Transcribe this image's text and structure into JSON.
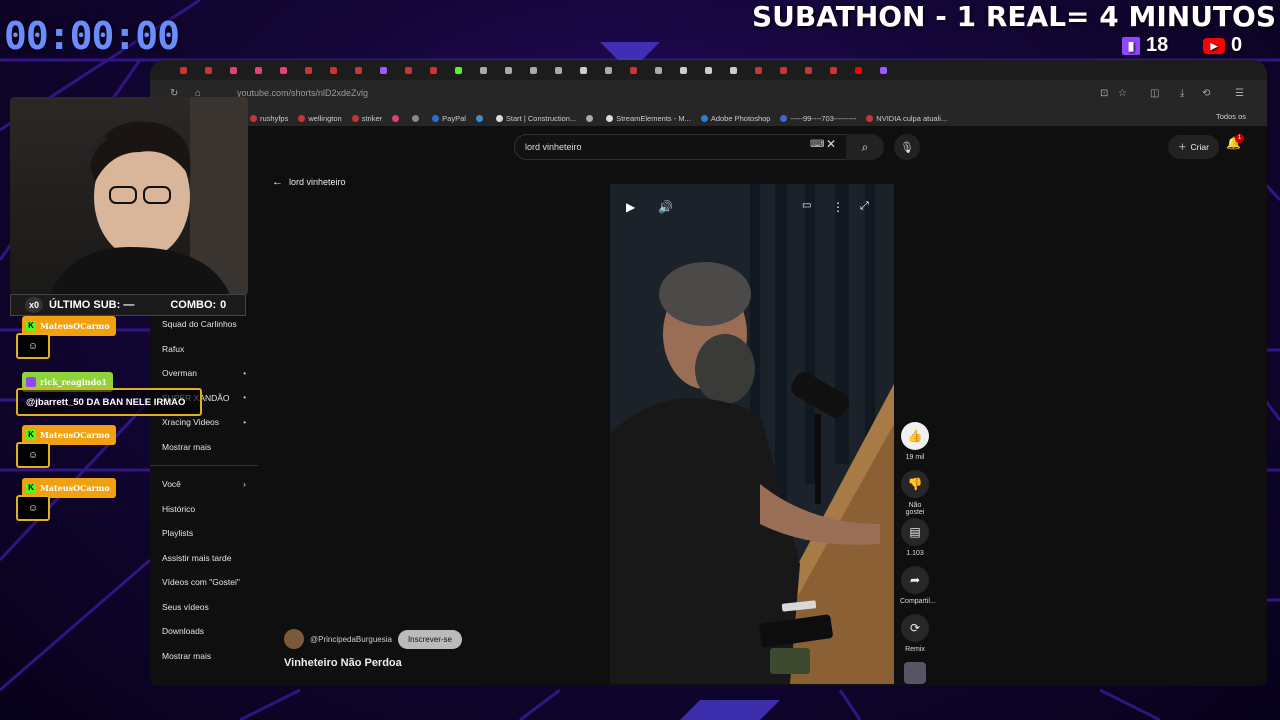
{
  "overlay": {
    "timer": "00:00:00",
    "subathon": "SUBATHON - 1 REAL= 4 MINUTOS",
    "twitch_count": "18",
    "youtube_count": "0",
    "last_sub_multiplier": "x0",
    "last_sub_label": "ÚLTIMO SUB: —",
    "combo_label": "COMBO:",
    "combo_value": "0"
  },
  "chat": [
    {
      "user": "MateusOCarmo",
      "platform": "kick",
      "color": "#f0a010"
    },
    {
      "user": "rick_reagindo1",
      "platform": "twitch",
      "color": "#8fd33a",
      "message": "@jbarrett_50 DA BAN NELE IRMAO"
    },
    {
      "user": "MateusOCarmo",
      "platform": "kick",
      "color": "#f0a010"
    },
    {
      "user": "MateusOCarmo",
      "platform": "kick",
      "color": "#f0a010"
    }
  ],
  "browser": {
    "url": "youtube.com/shorts/nlD2xdeZvlg",
    "bookmarks": [
      {
        "label": "rushyfps",
        "color": "#cc3333"
      },
      {
        "label": "wellington",
        "color": "#cc3333"
      },
      {
        "label": "striker",
        "color": "#cc3333"
      },
      {
        "label": "",
        "color": "#e04080"
      },
      {
        "label": "",
        "color": "#888888"
      },
      {
        "label": "PayPal",
        "color": "#2a6fd6"
      },
      {
        "label": "",
        "color": "#3a8fd6"
      },
      {
        "label": "Start | Construction...",
        "color": "#dddddd"
      },
      {
        "label": "",
        "color": "#aaaaaa"
      },
      {
        "label": "StreamElements - M...",
        "color": "#dddddd"
      },
      {
        "label": "Adobe Photoshop",
        "color": "#2a7fd6"
      },
      {
        "label": "-----99----703---------",
        "color": "#3a6ad6"
      },
      {
        "label": "NVIDIA culpa atuali...",
        "color": "#cc3333"
      }
    ],
    "bookmarks_all": "Todos os"
  },
  "youtube": {
    "search_value": "lord vinheteiro",
    "create_label": "Criar",
    "notif_count": "1",
    "back_label": "lord vinheteiro",
    "sidebar_top": [
      {
        "label": "Squad do Carlinhos",
        "dot": ""
      },
      {
        "label": "Rafux",
        "dot": ""
      },
      {
        "label": "Overman",
        "dot": "•"
      },
      {
        "label": "SUPER XANDÃO",
        "dot": "•"
      },
      {
        "label": "Xracing Videos",
        "dot": "•"
      },
      {
        "label": "Mostrar mais",
        "dot": ""
      }
    ],
    "you_label": "Você",
    "sidebar_bottom": [
      {
        "label": "Histórico"
      },
      {
        "label": "Playlists"
      },
      {
        "label": "Assistir mais tarde"
      },
      {
        "label": "Vídeos com \"Gostei\""
      },
      {
        "label": "Seus vídeos"
      },
      {
        "label": "Downloads"
      },
      {
        "label": "Mostrar mais"
      }
    ],
    "channel": "@PrincipedaBurguesia",
    "subscribe_label": "Inscrever-se",
    "video_title": "Vinheteiro Não Perdoa",
    "actions": {
      "likes": "19 mil",
      "dislike": "Não gostei",
      "comments": "1.103",
      "share": "Compartil...",
      "remix": "Remix"
    }
  }
}
